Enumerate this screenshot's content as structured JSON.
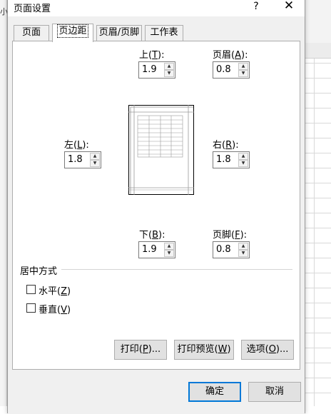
{
  "background": {
    "left_text": "小"
  },
  "dialog": {
    "title": "页面设置",
    "help_label": "?",
    "close_label": "✕"
  },
  "tabs": [
    {
      "label": "页面",
      "active": false
    },
    {
      "label": "页边距",
      "active": true
    },
    {
      "label": "页眉/页脚",
      "active": false
    },
    {
      "label": "工作表",
      "active": false
    }
  ],
  "margins": {
    "top": {
      "label": "上",
      "key": "T",
      "value": "1.9"
    },
    "header": {
      "label": "页眉",
      "key": "A",
      "value": "0.8"
    },
    "left": {
      "label": "左",
      "key": "L",
      "value": "1.8"
    },
    "right": {
      "label": "右",
      "key": "R",
      "value": "1.8"
    },
    "bottom": {
      "label": "下",
      "key": "B",
      "value": "1.9"
    },
    "footer": {
      "label": "页脚",
      "key": "F",
      "value": "0.8"
    }
  },
  "center_on_page": {
    "title": "居中方式",
    "horizontal": {
      "label": "水平",
      "key": "Z",
      "checked": false
    },
    "vertical": {
      "label": "垂直",
      "key": "V",
      "checked": false
    }
  },
  "buttons": {
    "print": {
      "label": "打印",
      "key": "P",
      "suffix": "..."
    },
    "preview": {
      "label": "打印预览",
      "key": "W",
      "suffix": ""
    },
    "options": {
      "label": "选项",
      "key": "O",
      "suffix": "..."
    },
    "ok": "确定",
    "cancel": "取消"
  },
  "spin_icons": {
    "up": "▲",
    "down": "▼"
  }
}
